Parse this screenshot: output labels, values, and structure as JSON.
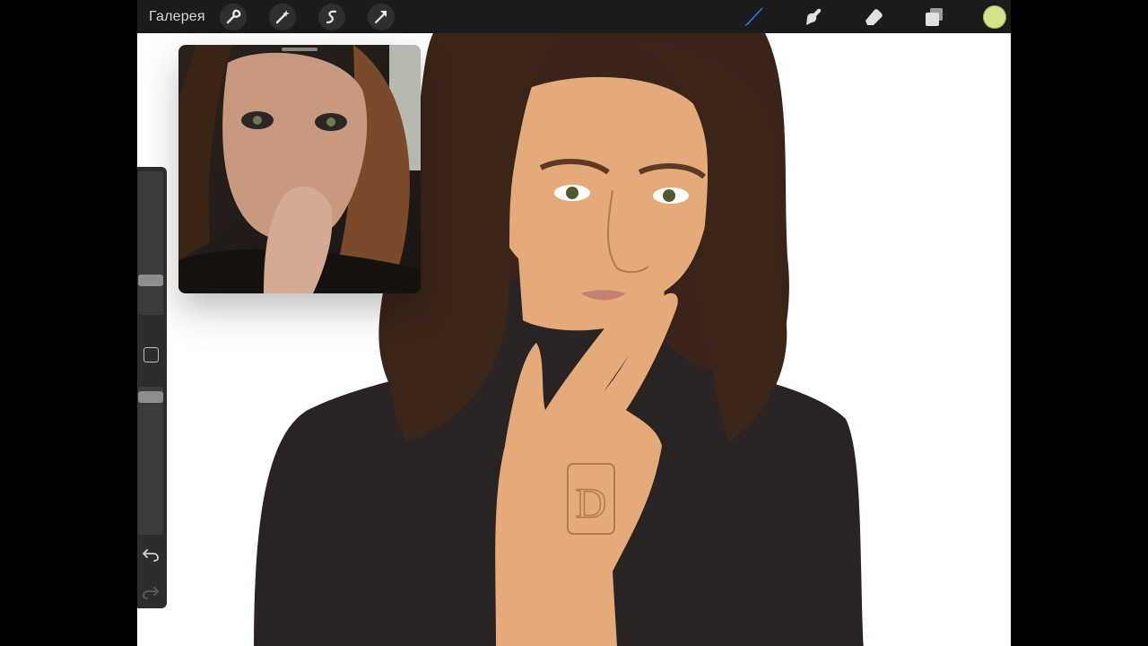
{
  "topbar": {
    "gallery_label": "Галерея",
    "left_tools": [
      {
        "name": "wrench-icon"
      },
      {
        "name": "magic-wand-icon"
      },
      {
        "name": "selection-icon"
      },
      {
        "name": "arrow-transform-icon"
      }
    ],
    "right_tools": [
      {
        "name": "brush-icon",
        "active": true,
        "color": "#2b7cf6"
      },
      {
        "name": "smudge-icon"
      },
      {
        "name": "eraser-icon"
      },
      {
        "name": "layers-icon"
      }
    ],
    "current_color": "#d7e38b"
  },
  "sidebar": {
    "brush_size_level": 0.28,
    "opacity_level": 1.0,
    "icons": [
      "modify-square-icon",
      "undo-icon",
      "redo-icon"
    ]
  },
  "reference_window": {
    "visible": true
  },
  "colors": {
    "toolbar_bg": "#1b1b1c",
    "canvas_bg": "#ffffff",
    "hair": "#3a2318",
    "skin": "#e4aa79",
    "sweater": "#2a2324"
  }
}
